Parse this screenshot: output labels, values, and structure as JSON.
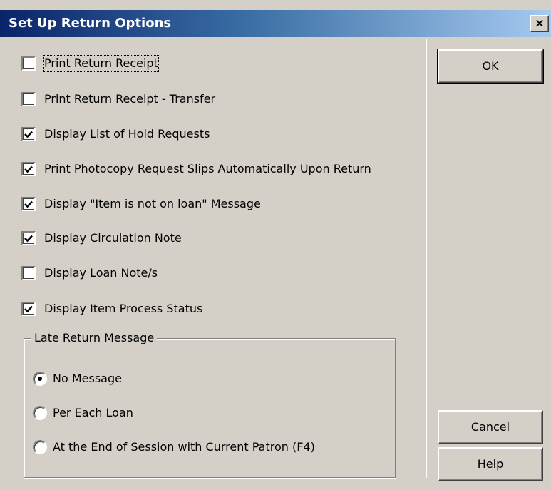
{
  "window": {
    "title": "Set Up Return Options",
    "close_glyph": "×"
  },
  "options": [
    {
      "label": "Print Return Receipt",
      "checked": false
    },
    {
      "label": "Print Return Receipt - Transfer",
      "checked": false
    },
    {
      "label": "Display List of Hold Requests",
      "checked": true
    },
    {
      "label": "Print Photocopy Request Slips Automatically Upon Return",
      "checked": true
    },
    {
      "label": "Display \"Item is not on loan\" Message",
      "checked": true
    },
    {
      "label": "Display Circulation Note",
      "checked": true
    },
    {
      "label": "Display Loan Note/s",
      "checked": false
    },
    {
      "label": "Display Item Process Status",
      "checked": true
    }
  ],
  "late_return": {
    "legend": "Late Return Message",
    "choices": [
      {
        "label": "No Message",
        "selected": true
      },
      {
        "label": "Per Each Loan",
        "selected": false
      },
      {
        "label": "At the End of Session with Current Patron (F4)",
        "selected": false
      }
    ]
  },
  "buttons": {
    "ok": {
      "accel": "O",
      "rest": "K"
    },
    "cancel": {
      "accel": "C",
      "rest": "ancel"
    },
    "help": {
      "accel": "H",
      "rest": "elp"
    }
  },
  "icons": {
    "close": "close-icon",
    "check": "checkmark-icon",
    "radio_dot": "radio-dot-icon"
  }
}
